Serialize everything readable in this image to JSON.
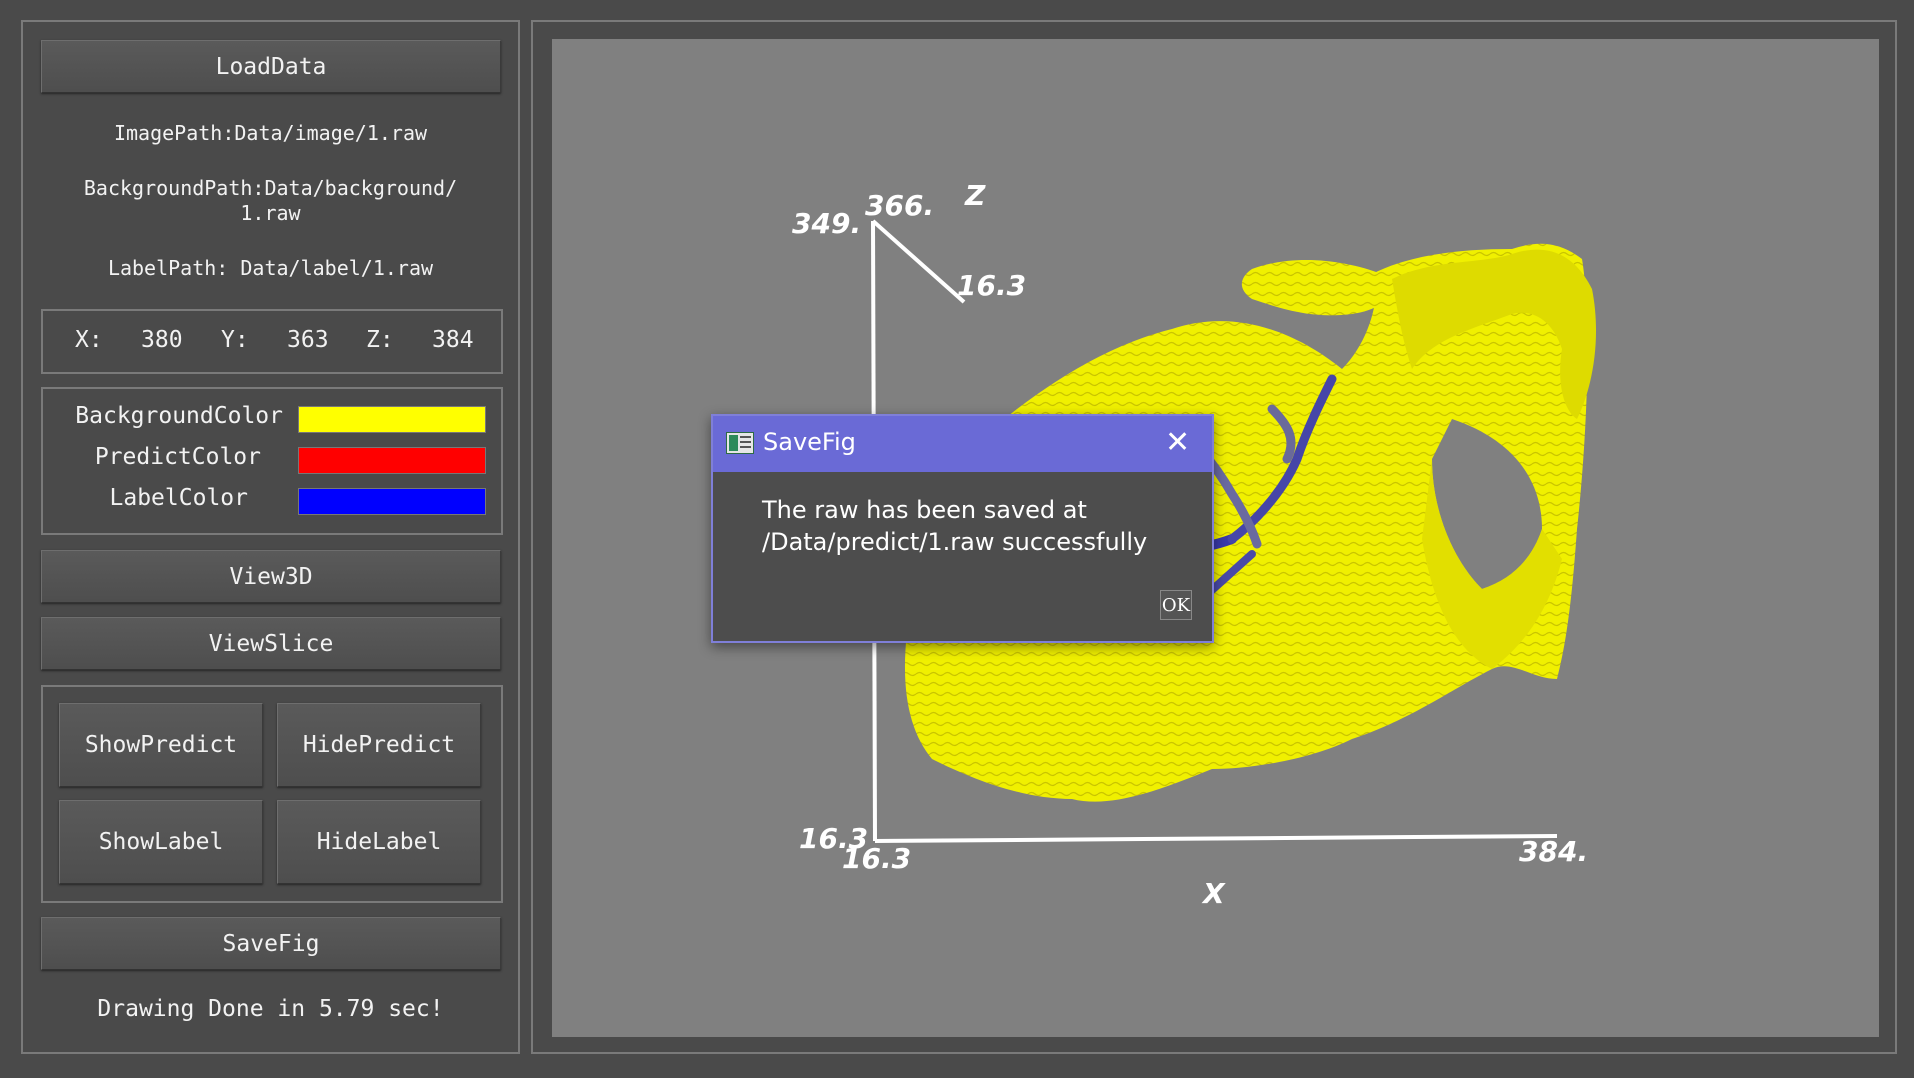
{
  "left_panel": {
    "load_button": "LoadData",
    "image_path": "ImagePath:Data/image/1.raw",
    "background_path_line1": "BackgroundPath:Data/background/",
    "background_path_line2": "1.raw",
    "label_path": "LabelPath: Data/label/1.raw",
    "coords": {
      "x_label": "X:",
      "x_value": "380",
      "y_label": "Y:",
      "y_value": "363",
      "z_label": "Z:",
      "z_value": "384"
    },
    "colors": [
      {
        "label": "BackgroundColor",
        "color": "#ffff00"
      },
      {
        "label": "PredictColor",
        "color": "#ff0000"
      },
      {
        "label": "LabelColor",
        "color": "#0000ff"
      }
    ],
    "view3d_button": "View3D",
    "viewslice_button": "ViewSlice",
    "show_predict_button": "ShowPredict",
    "hide_predict_button": "HidePredict",
    "show_label_button": "ShowLabel",
    "hide_label_button": "HideLabel",
    "savefig_button": "SaveFig",
    "status": "Drawing Done in 5.79 sec!"
  },
  "viewport": {
    "axes": {
      "z_label": "Z",
      "x_label": "X",
      "z_top_a": "349.",
      "z_top_b": "366.",
      "y_end": "16.3",
      "origin_a": "16.3",
      "origin_b": "16.3",
      "x_end": "384."
    },
    "mesh_color": "#ffff00",
    "label_color": "#3a3aaa"
  },
  "dialog": {
    "title": "SaveFig",
    "message": "The raw has been saved at /Data/predict/1.raw successfully",
    "ok_button": "OK",
    "close_glyph": "✕"
  }
}
